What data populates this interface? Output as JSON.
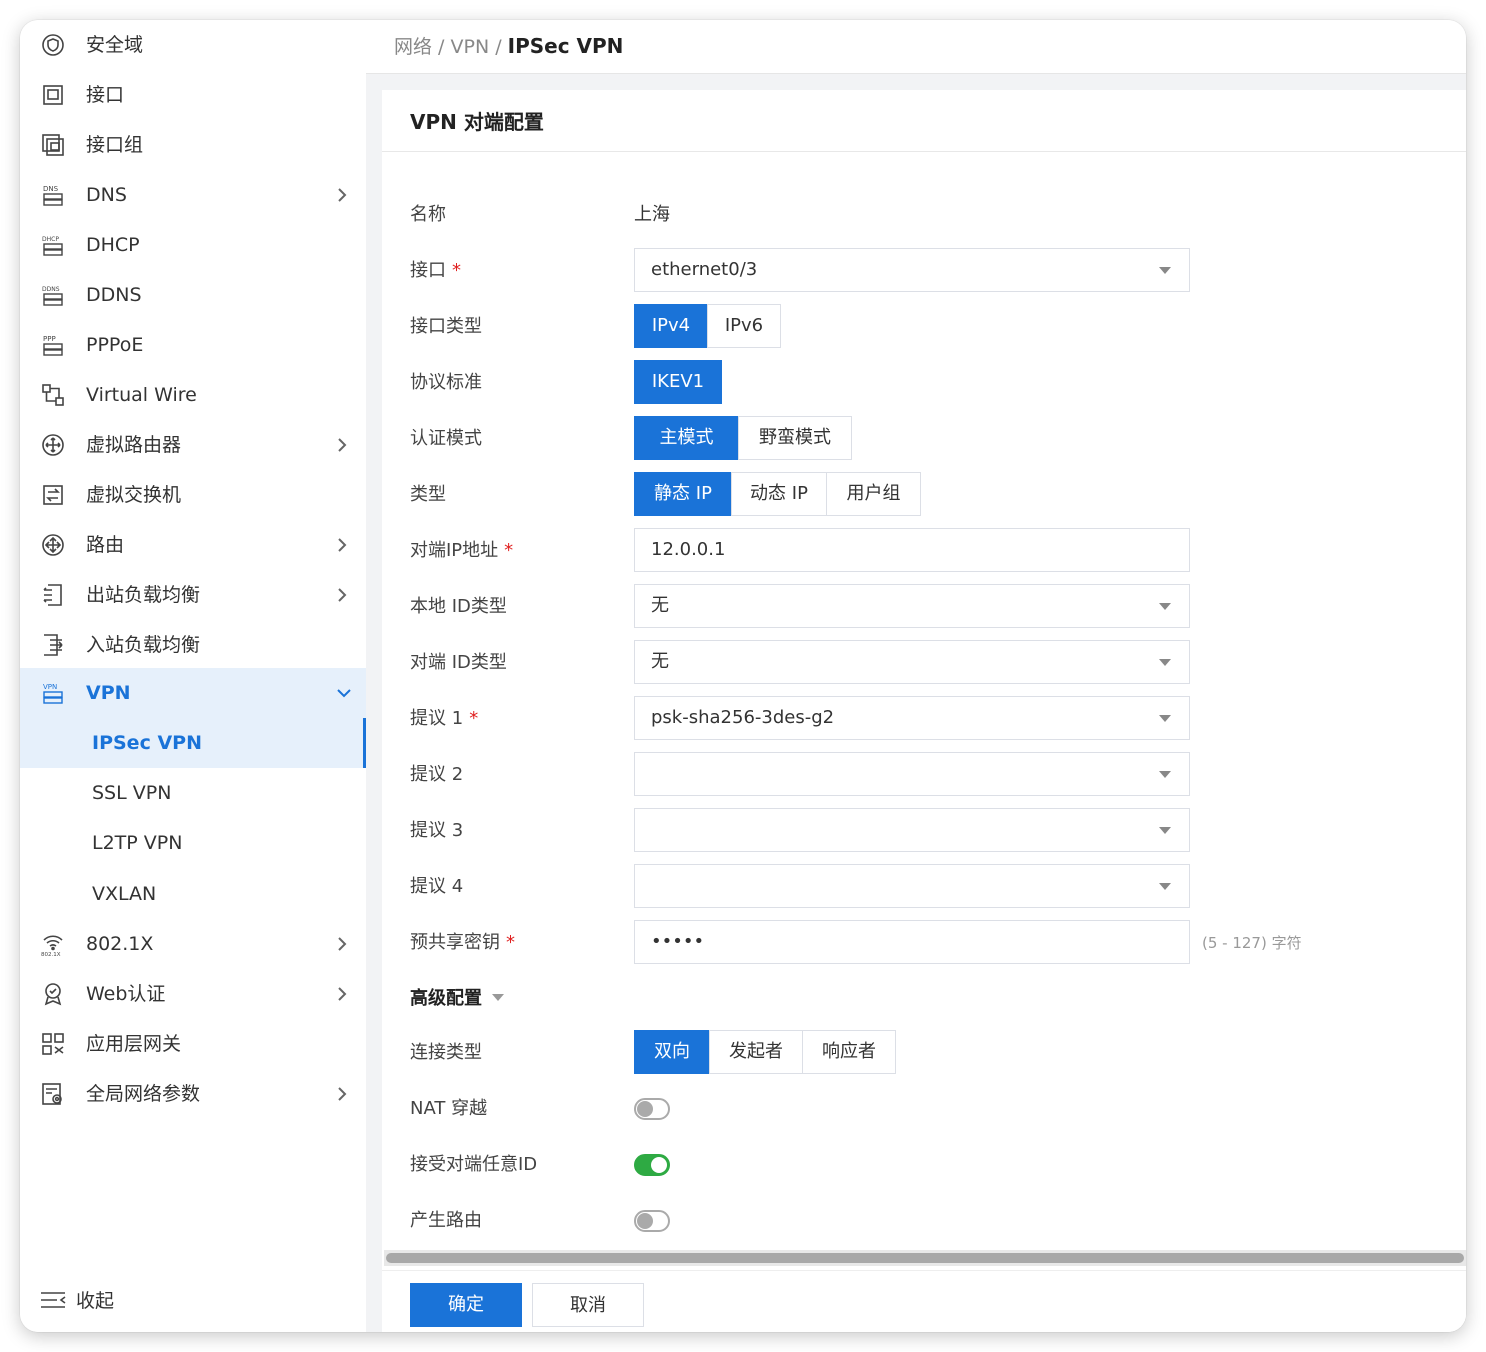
{
  "sidebar": {
    "items": [
      {
        "label": "安全域",
        "icon": "shield-icon",
        "has_chevron": false
      },
      {
        "label": "接口",
        "icon": "interface-icon",
        "has_chevron": false
      },
      {
        "label": "接口组",
        "icon": "interface-group-icon",
        "has_chevron": false
      },
      {
        "label": "DNS",
        "icon": "dns-icon",
        "has_chevron": true
      },
      {
        "label": "DHCP",
        "icon": "dhcp-icon",
        "has_chevron": false
      },
      {
        "label": "DDNS",
        "icon": "ddns-icon",
        "has_chevron": false
      },
      {
        "label": "PPPoE",
        "icon": "pppoe-icon",
        "has_chevron": false
      },
      {
        "label": "Virtual Wire",
        "icon": "virtual-wire-icon",
        "has_chevron": false
      },
      {
        "label": "虚拟路由器",
        "icon": "virtual-router-icon",
        "has_chevron": true
      },
      {
        "label": "虚拟交换机",
        "icon": "virtual-switch-icon",
        "has_chevron": false
      },
      {
        "label": "路由",
        "icon": "route-icon",
        "has_chevron": true
      },
      {
        "label": "出站负载均衡",
        "icon": "outbound-lb-icon",
        "has_chevron": true
      },
      {
        "label": "入站负载均衡",
        "icon": "inbound-lb-icon",
        "has_chevron": false
      },
      {
        "label": "VPN",
        "icon": "vpn-icon",
        "has_chevron": true
      }
    ],
    "vpn_sub_items": [
      {
        "label": "IPSec VPN"
      },
      {
        "label": "SSL VPN"
      },
      {
        "label": "L2TP VPN"
      },
      {
        "label": "VXLAN"
      }
    ],
    "items_after": [
      {
        "label": "802.1X",
        "icon": "wifi-8021x-icon",
        "has_chevron": true
      },
      {
        "label": "Web认证",
        "icon": "web-auth-icon",
        "has_chevron": true
      },
      {
        "label": "应用层网关",
        "icon": "app-gateway-icon",
        "has_chevron": false
      },
      {
        "label": "全局网络参数",
        "icon": "global-params-icon",
        "has_chevron": true
      }
    ],
    "collapse_label": "收起"
  },
  "header": {
    "breadcrumb": [
      "网络",
      "VPN"
    ],
    "separator": " / ",
    "current": "IPSec VPN"
  },
  "panel": {
    "title": "VPN 对端配置",
    "name_label": "名称",
    "name_value": "上海",
    "interface_label": "接口",
    "interface_value": "ethernet0/3",
    "interface_type_label": "接口类型",
    "interface_type_options": [
      "IPv4",
      "IPv6"
    ],
    "protocol_label": "协议标准",
    "protocol_options": [
      "IKEV1"
    ],
    "auth_mode_label": "认证模式",
    "auth_mode_options": [
      "主模式",
      "野蛮模式"
    ],
    "type_label": "类型",
    "type_options": [
      "静态 IP",
      "动态 IP",
      "用户组"
    ],
    "peer_ip_label": "对端IP地址",
    "peer_ip_value": "12.0.0.1",
    "local_id_label": "本地 ID类型",
    "local_id_value": "无",
    "peer_id_label": "对端 ID类型",
    "peer_id_value": "无",
    "proposal1_label": "提议 1",
    "proposal1_value": "psk-sha256-3des-g2",
    "proposal2_label": "提议 2",
    "proposal2_value": "",
    "proposal3_label": "提议 3",
    "proposal3_value": "",
    "proposal4_label": "提议 4",
    "proposal4_value": "",
    "psk_label": "预共享密钥",
    "psk_value": "•••••",
    "psk_hint": "(5 - 127) 字符",
    "advanced_label": "高级配置",
    "connection_label": "连接类型",
    "connection_options": [
      "双向",
      "发起者",
      "响应者"
    ],
    "nat_label": "NAT 穿越",
    "nat_on": false,
    "accept_any_id_label": "接受对端任意ID",
    "accept_any_id_on": true,
    "gen_route_label": "产生路由",
    "gen_route_on": false,
    "required_mark": "*"
  },
  "footer": {
    "confirm_label": "确定",
    "cancel_label": "取消"
  },
  "colors": {
    "accent": "#1a73d8",
    "active_bg": "#e6f0fb",
    "toggle_on": "#2eaa43"
  }
}
